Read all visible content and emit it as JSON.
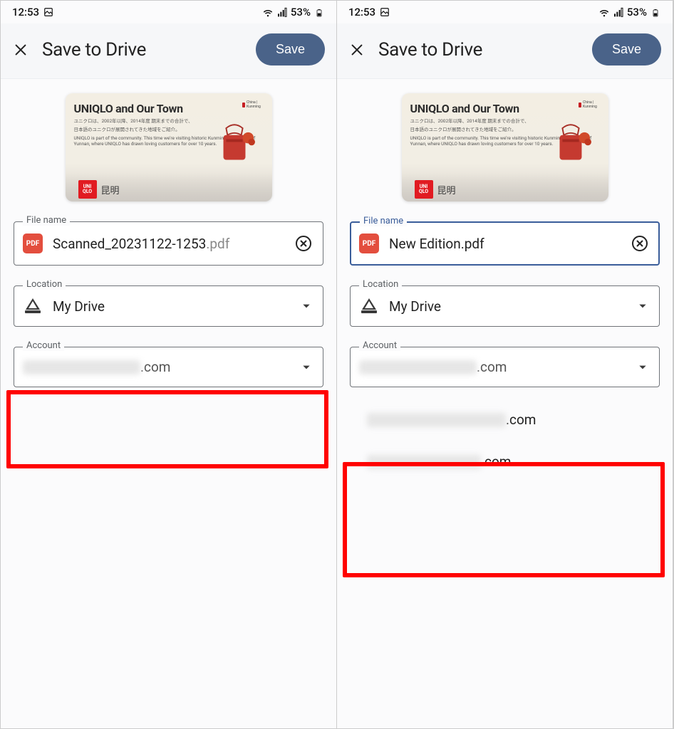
{
  "statusbar": {
    "time": "12:53",
    "battery": "53%"
  },
  "header": {
    "title": "Save to Drive",
    "save_label": "Save"
  },
  "preview": {
    "poster_title": "UNIQLO and Our Town",
    "poster_blurb1": "ユニクロは、2002年以降、2014年度 期末までの合計で、",
    "poster_blurb2": "日本語のユニクロが展開されてきた地域をご紹介。",
    "poster_blurb3": "UNIQLO is part of the community. This time we're visiting historic Kunming, the capital of Yunnan, where UNIQLO has drawn loving customers for over 10 years.",
    "brand_badge": "UNI\nQLO",
    "town_char": "昆明",
    "tag_label": "China | Kunming"
  },
  "fields": {
    "file_name_label": "File name",
    "location_label": "Location",
    "account_label": "Account",
    "location_value": "My Drive",
    "account_suffix": ".com"
  },
  "left": {
    "file_name": "Scanned_20231122-1253",
    "file_ext": ".pdf"
  },
  "right": {
    "file_name": "New Edition.pdf",
    "options": [
      {
        "suffix": ".com"
      },
      {
        "suffix": ".com"
      }
    ]
  },
  "icons": {
    "pdf": "PDF"
  }
}
